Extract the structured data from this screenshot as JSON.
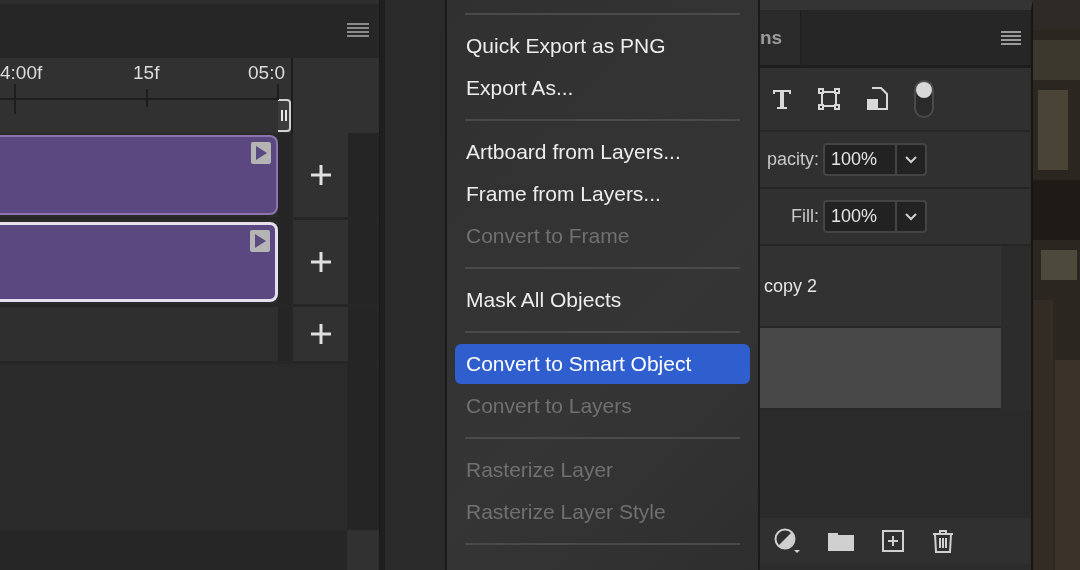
{
  "timeline": {
    "ruler_labels": [
      "4:00f",
      "15f",
      "05:0"
    ],
    "tracks": [
      {
        "kind": "clip",
        "selected": false
      },
      {
        "kind": "clip",
        "selected": true
      },
      {
        "kind": "empty",
        "selected": false
      }
    ]
  },
  "menu": {
    "items": [
      {
        "kind": "separator"
      },
      {
        "kind": "item",
        "label": "Quick Export as PNG",
        "disabled": false,
        "selected": false
      },
      {
        "kind": "item",
        "label": "Export As...",
        "disabled": false,
        "selected": false
      },
      {
        "kind": "separator"
      },
      {
        "kind": "item",
        "label": "Artboard from Layers...",
        "disabled": false,
        "selected": false
      },
      {
        "kind": "item",
        "label": "Frame from Layers...",
        "disabled": false,
        "selected": false
      },
      {
        "kind": "item",
        "label": "Convert to Frame",
        "disabled": true,
        "selected": false
      },
      {
        "kind": "separator"
      },
      {
        "kind": "item",
        "label": "Mask All Objects",
        "disabled": false,
        "selected": false
      },
      {
        "kind": "separator"
      },
      {
        "kind": "item",
        "label": "Convert to Smart Object",
        "disabled": false,
        "selected": true
      },
      {
        "kind": "item",
        "label": "Convert to Layers",
        "disabled": true,
        "selected": false
      },
      {
        "kind": "separator"
      },
      {
        "kind": "item",
        "label": "Rasterize Layer",
        "disabled": true,
        "selected": false
      },
      {
        "kind": "item",
        "label": "Rasterize Layer Style",
        "disabled": true,
        "selected": false
      },
      {
        "kind": "separator"
      }
    ]
  },
  "layers_panel": {
    "tab_label": "ns",
    "opacity_label": "pacity:",
    "opacity_value": "100%",
    "fill_label": "Fill:",
    "fill_value": "100%",
    "layers": [
      {
        "name": "copy 2",
        "selected": false
      },
      {
        "selected": true
      }
    ]
  }
}
